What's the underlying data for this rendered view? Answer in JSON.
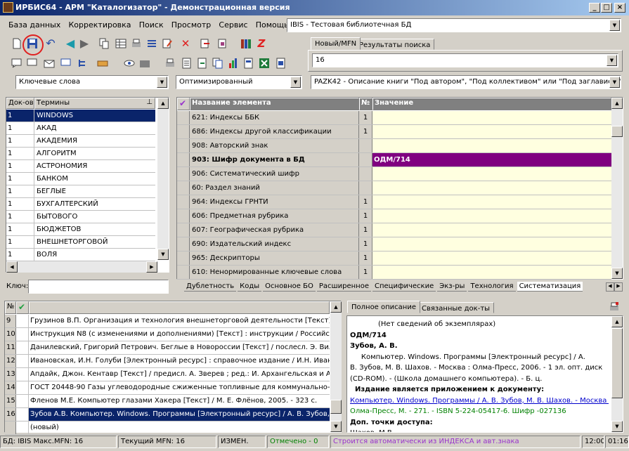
{
  "window": {
    "title": "ИРБИС64 - АРМ \"Каталогизатор\" - Демонстрационная версия"
  },
  "menu": [
    "База данных",
    "Корректировка",
    "Поиск",
    "Просмотр",
    "Сервис",
    "Помощь"
  ],
  "db_select": "IBIS - Тестовая библиотечная БД",
  "search_tabs": [
    "Новый/MFN",
    "Результаты поиска"
  ],
  "mfn_value": "16",
  "filters": {
    "dictionary": "Ключевые слова",
    "mode": "Оптимизированный",
    "worksheet": "PAZK42 - Описание книги \"Под автором\", \"Под коллективом\" или \"Под заглавием\""
  },
  "terms": {
    "headers": [
      "Док-ов",
      "Термины"
    ],
    "rows": [
      {
        "count": "1",
        "term": "WINDOWS"
      },
      {
        "count": "1",
        "term": "АКАД"
      },
      {
        "count": "1",
        "term": "АКАДЕМИЯ"
      },
      {
        "count": "1",
        "term": "АЛГОРИТМ"
      },
      {
        "count": "1",
        "term": "АСТРОНОМИЯ"
      },
      {
        "count": "1",
        "term": "БАНКОМ"
      },
      {
        "count": "1",
        "term": "БЕГЛЫЕ"
      },
      {
        "count": "1",
        "term": "БУХГАЛТЕРСКИЙ"
      },
      {
        "count": "1",
        "term": "БЫТОВОГО"
      },
      {
        "count": "1",
        "term": "БЮДЖЕТОВ"
      },
      {
        "count": "1",
        "term": "ВНЕШНЕТОРГОВОЙ"
      },
      {
        "count": "1",
        "term": "ВОЛЯ"
      }
    ],
    "key_label": "Ключ:"
  },
  "fields": {
    "headers": [
      "Название элемента",
      "№",
      "Значение"
    ],
    "rows": [
      {
        "name": "621: Индексы ББК",
        "num": "1",
        "value": ""
      },
      {
        "name": "686: Индексы другой классификации",
        "num": "1",
        "value": ""
      },
      {
        "name": "908: Авторский знак",
        "num": "",
        "value": ""
      },
      {
        "name": "903: Шифр документа в БД",
        "num": "",
        "value": "ОДМ/714"
      },
      {
        "name": "906: Систематический шифр",
        "num": "",
        "value": ""
      },
      {
        "name": "60: Раздел знаний",
        "num": "",
        "value": ""
      },
      {
        "name": "964: Индексы ГРНТИ",
        "num": "1",
        "value": ""
      },
      {
        "name": "606: Предметная рубрика",
        "num": "1",
        "value": ""
      },
      {
        "name": "607: Географическая рубрика",
        "num": "1",
        "value": ""
      },
      {
        "name": "690: Издательский индекс",
        "num": "1",
        "value": ""
      },
      {
        "name": "965: Дескрипторы",
        "num": "1",
        "value": ""
      },
      {
        "name": "610: Ненормированные ключевые слова",
        "num": "1",
        "value": ""
      }
    ],
    "bottom_tabs": [
      "Дублетность",
      "Коды",
      "Основное БО",
      "Расширенное",
      "Специфические",
      "Экз-ры",
      "Технология",
      "Систематизация"
    ]
  },
  "records": {
    "headers": [
      "№"
    ],
    "rows": [
      {
        "num": "9",
        "text": "Грузинов В.П. Организация и технология внешнеторговой деятельности [Текст] : Те"
      },
      {
        "num": "10",
        "text": "Инструкция N8   (с изменениями и дополнениями) [Текст] : инструкции / Российска"
      },
      {
        "num": "11",
        "text": "Данилевский, Григорий Петрович. Беглые в Новороссии [Текст] / послесл. Э. Виле"
      },
      {
        "num": "12",
        "text": "Ивановская, И.Н. Голуби [Электронный ресурс] : справочное издание / И.Н. Ивано"
      },
      {
        "num": "13",
        "text": "Апдайк, Джон. Кентавр [Текст] / предисл. А. Зверев ; ред.: И. Архангельская и А. К"
      },
      {
        "num": "14",
        "text": "ГОСТ 20448-90 Газы углеводородные сжиженные топливные для коммунально-быт"
      },
      {
        "num": "15",
        "text": "Фленов М.Е. Компьютер глазами Хакера [Текст] / М. Е. Флёнов, 2005. - 323 с."
      },
      {
        "num": "16",
        "text": "Зубов А.В. Компьютер. Windows. Программы [Электронный ресурс] / А. В. Зубов, М"
      },
      {
        "num": "",
        "text": "(новый)"
      }
    ]
  },
  "description": {
    "tabs": [
      "Полное описание",
      "Связанные док-ты"
    ],
    "lines": [
      {
        "t": "(Нет сведений об экземплярах)",
        "cls": "center"
      },
      {
        "t": "ОДМ/714",
        "cls": "bold"
      },
      {
        "t": "Зубов, А. В.",
        "cls": "bold"
      },
      {
        "t": "     Компьютер. Windows. Программы [Электронный ресурс] / А.",
        "cls": "indent"
      },
      {
        "t": "В. Зубов, М. В. Шахов. - Москва : Олма-Пресс, 2006. - 1 эл. опт. диск",
        "cls": ""
      },
      {
        "t": "(CD-ROM). - (Школа домашнего компьютера). - Б. ц.",
        "cls": ""
      },
      {
        "t": "  Издание является приложением к документу:",
        "cls": "bold"
      },
      {
        "t": "Компьютер. Windows. Программы / А. В. Зубов, М. В. Шахов. - Москва :",
        "cls": "link"
      },
      {
        "t": "Олма-Пресс, М. - 271. - ISBN 5-224-05417-6. Шифр -027136",
        "cls": "green"
      },
      {
        "t": "Доп. точки доступа:",
        "cls": "bold"
      },
      {
        "t": "Шахов, М.В.",
        "cls": ""
      }
    ]
  },
  "status": {
    "db": "БД: IBIS Макс.MFN: 16",
    "current": "Текущий MFN: 16",
    "changed": "ИЗМЕН.",
    "marked": "Отмечено - 0",
    "info": "Строится автоматически из ИНДЕКСА и авт.знака",
    "time": "12:00",
    "date": "01:16"
  },
  "colors": {
    "selection": "#0a246a",
    "field_highlight": "#800080",
    "value_bg": "#ffffe0",
    "green": "#008000",
    "purple_text": "#9933cc",
    "link": "#0000cc"
  }
}
